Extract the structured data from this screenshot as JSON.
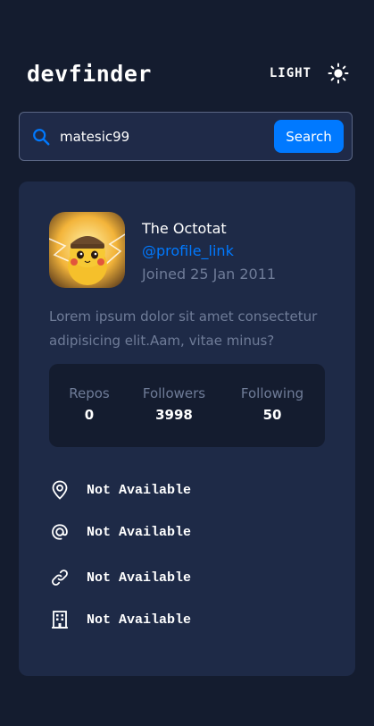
{
  "header": {
    "logo": "devfinder",
    "theme_label": "LIGHT",
    "theme_icon": "sun-icon"
  },
  "search": {
    "value": "matesic99",
    "button_label": "Search",
    "icon": "search-icon"
  },
  "profile": {
    "name": "The Octotat",
    "link": "@profile_link",
    "joined": "Joined 25 Jan 2011",
    "bio": "Lorem ipsum dolor sit amet consectetur adipisicing elit.Aam, vitae minus?",
    "stats": [
      {
        "label": "Repos",
        "value": "0"
      },
      {
        "label": "Followers",
        "value": "3998"
      },
      {
        "label": "Following",
        "value": "50"
      }
    ],
    "info": [
      {
        "icon": "location-pin-icon",
        "text": "Not Available"
      },
      {
        "icon": "at-sign-icon",
        "text": "Not Available"
      },
      {
        "icon": "link-icon",
        "text": "Not Available"
      },
      {
        "icon": "building-icon",
        "text": "Not Available"
      }
    ]
  },
  "colors": {
    "background": "#141c2f",
    "card": "#1e2a47",
    "accent": "#0079ff",
    "muted_text": "#6f7c98"
  }
}
